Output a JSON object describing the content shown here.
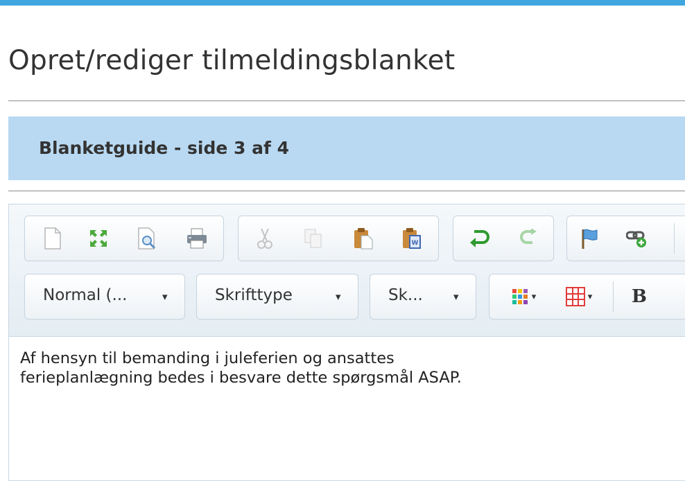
{
  "page": {
    "title": "Opret/rediger tilmeldingsblanket"
  },
  "wizard": {
    "title": "Blanketguide - side 3 af 4"
  },
  "toolbar": {
    "row1_icons": [
      "new-page-icon",
      "maximize-icon",
      "preview-icon",
      "print-icon",
      "cut-icon",
      "copy-icon",
      "paste-icon",
      "paste-from-word-icon",
      "undo-icon",
      "redo-icon",
      "anchor-flag-icon",
      "link-icon"
    ],
    "format_label": "Normal (...",
    "font_label": "Skrifttype",
    "size_label": "Sk...",
    "bold_label": "B",
    "dropdown_arrow": "▾"
  },
  "editor": {
    "lines": [
      "Af hensyn til bemanding i juleferien og ansattes",
      "ferieplanlægning bedes i besvare dette spørgsmål ASAP."
    ]
  },
  "colors": {
    "accent_stripe": "#3fa6df",
    "wizard_band": "#b9d9f2"
  }
}
